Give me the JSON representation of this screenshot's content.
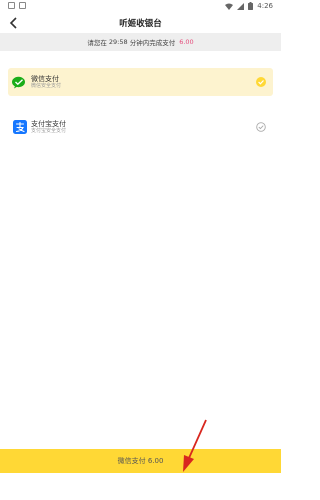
{
  "status_bar": {
    "time": "4:26"
  },
  "header": {
    "title": "听姬收银台"
  },
  "timer": {
    "prefix": "请您在",
    "countdown": "29:58",
    "suffix": "分钟内完成支付",
    "amount": "6.00"
  },
  "payment_options": [
    {
      "name": "微信支付",
      "subtitle": "微信安全支付",
      "selected": true
    },
    {
      "name": "支付宝支付",
      "subtitle": "支付宝安全支付",
      "selected": false
    }
  ],
  "bottom_button": {
    "label": "微信支付 6.00"
  },
  "colors": {
    "accent": "#ffd835",
    "amount": "#e44c7b",
    "wechat": "#1aad19",
    "alipay": "#1677ff"
  }
}
